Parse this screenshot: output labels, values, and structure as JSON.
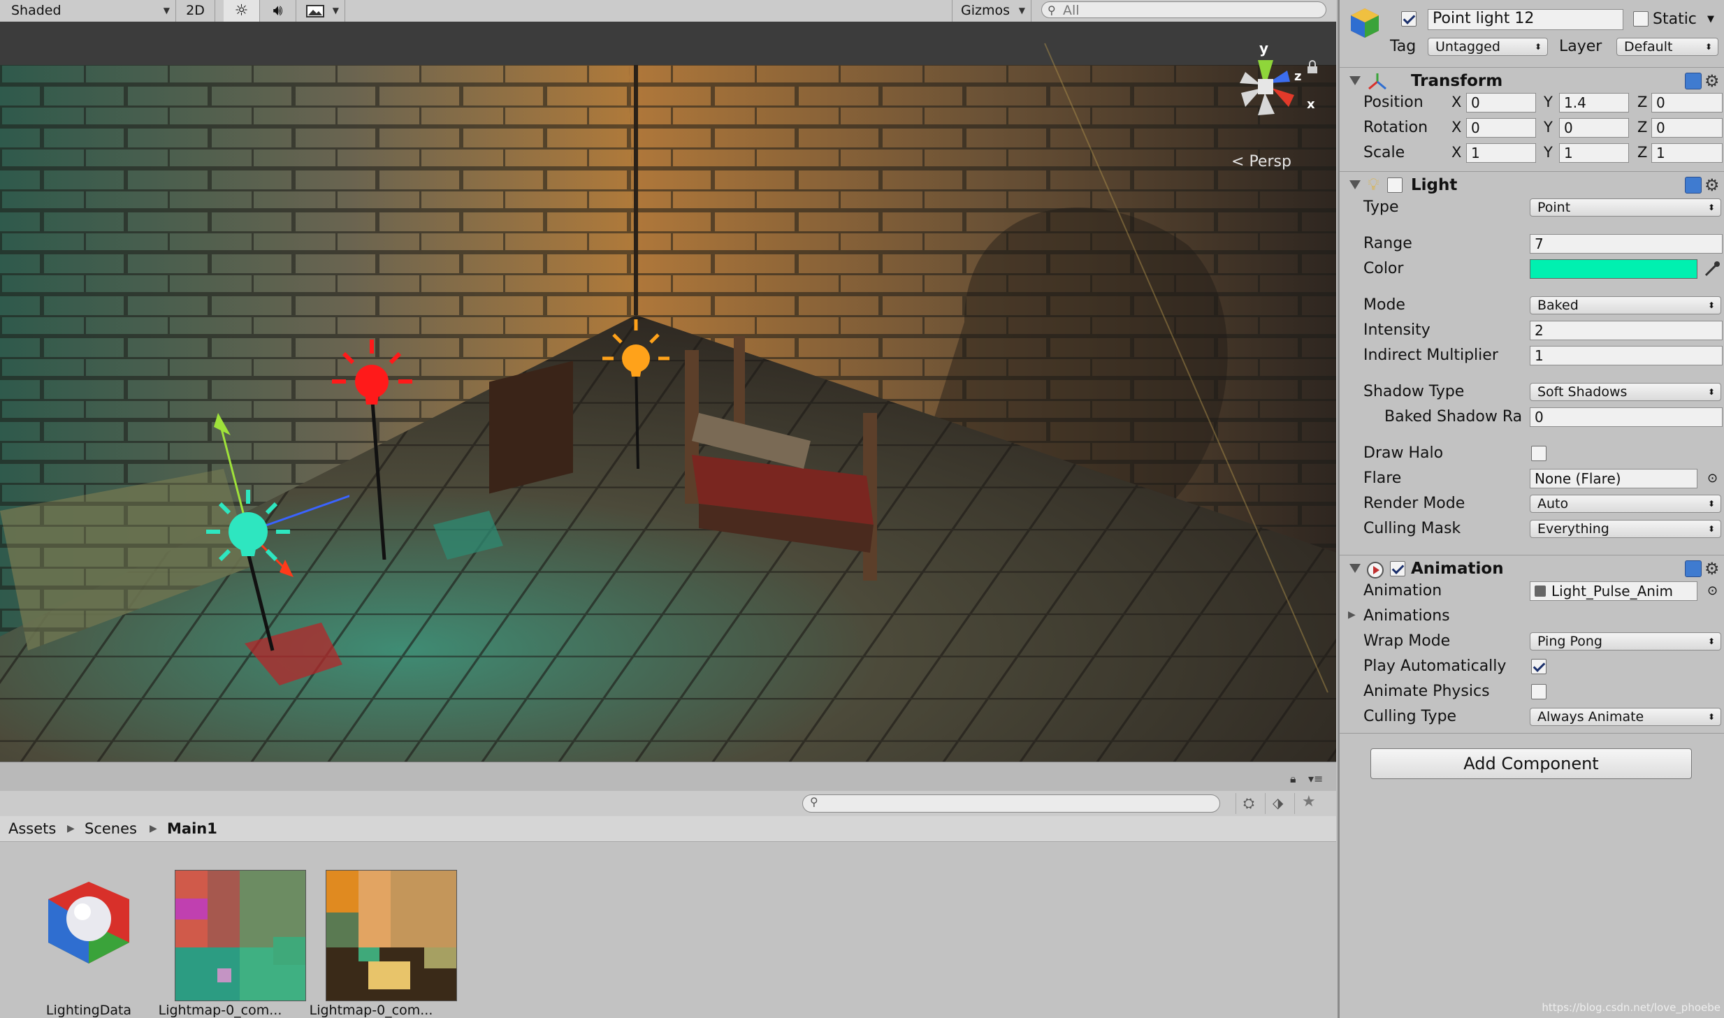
{
  "scene_toolbar": {
    "shading_mode": "Shaded",
    "mode_2d": "2D",
    "gizmos": "Gizmos",
    "search_placeholder": "All"
  },
  "scene": {
    "projection": "Persp",
    "axes": {
      "y": "y",
      "z": "z",
      "x": "x"
    },
    "light_colors": {
      "cyan": "#2ee6c0",
      "red": "#ff1a1a",
      "orange": "#ffa21a"
    }
  },
  "project": {
    "breadcrumb": [
      "Assets",
      "Scenes",
      "Main1"
    ],
    "assets": [
      {
        "label": "LightingData",
        "icon": "lighting-data-icon"
      },
      {
        "label": "Lightmap-0_com...",
        "icon": "lightmap-thumbnail"
      },
      {
        "label": "Lightmap-0_com...",
        "icon": "lightmap-thumbnail"
      }
    ]
  },
  "inspector": {
    "object_name": "Point light 12",
    "active": true,
    "static_label": "Static",
    "static": false,
    "tag_label": "Tag",
    "tag": "Untagged",
    "layer_label": "Layer",
    "layer": "Default",
    "transform": {
      "title": "Transform",
      "position_label": "Position",
      "rotation_label": "Rotation",
      "scale_label": "Scale",
      "position": {
        "x": "0",
        "y": "1.4",
        "z": "0"
      },
      "rotation": {
        "x": "0",
        "y": "0",
        "z": "0"
      },
      "scale": {
        "x": "1",
        "y": "1",
        "z": "1"
      },
      "axis_x": "X",
      "axis_y": "Y",
      "axis_z": "Z"
    },
    "light": {
      "title": "Light",
      "type_label": "Type",
      "type": "Point",
      "range_label": "Range",
      "range": "7",
      "color_label": "Color",
      "color": "#00f0b0",
      "mode_label": "Mode",
      "mode": "Baked",
      "intensity_label": "Intensity",
      "intensity": "2",
      "indirect_label": "Indirect Multiplier",
      "indirect": "1",
      "shadow_type_label": "Shadow Type",
      "shadow_type": "Soft Shadows",
      "baked_shadow_label": "Baked Shadow Ra",
      "baked_shadow": "0",
      "draw_halo_label": "Draw Halo",
      "draw_halo": false,
      "flare_label": "Flare",
      "flare": "None (Flare)",
      "render_mode_label": "Render Mode",
      "render_mode": "Auto",
      "culling_mask_label": "Culling Mask",
      "culling_mask": "Everything"
    },
    "animation": {
      "title": "Animation",
      "animation_label": "Animation",
      "animation": "Light_Pulse_Anim",
      "animations_label": "Animations",
      "wrap_mode_label": "Wrap Mode",
      "wrap_mode": "Ping Pong",
      "play_auto_label": "Play Automatically",
      "play_auto": true,
      "animate_physics_label": "Animate Physics",
      "animate_physics": false,
      "culling_type_label": "Culling Type",
      "culling_type": "Always Animate"
    },
    "add_component": "Add Component"
  },
  "watermark": "https://blog.csdn.net/love_phoebe"
}
